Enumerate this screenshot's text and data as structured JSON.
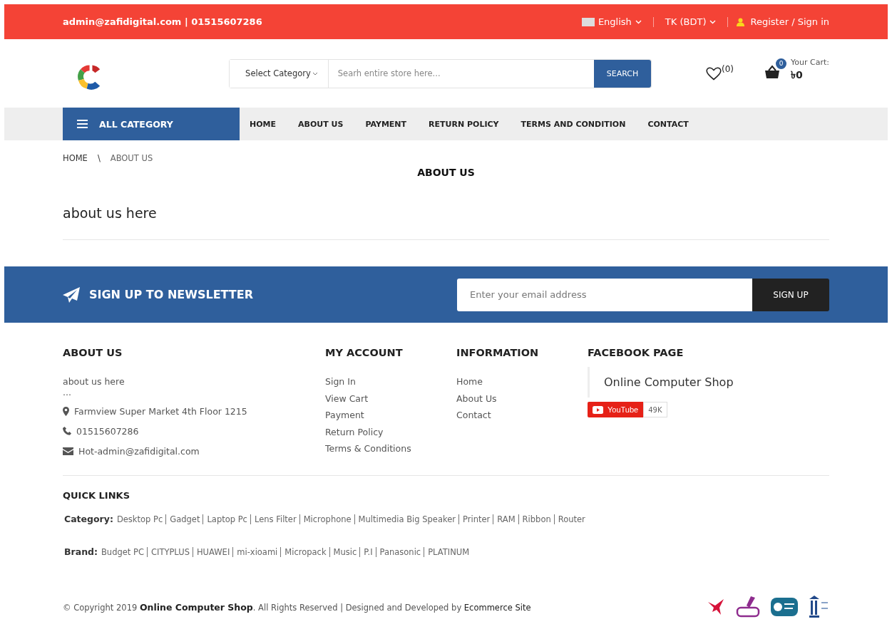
{
  "topbar": {
    "contact": "admin@zafidigital.com | 01515607286",
    "language": "English",
    "currency": "TK (BDT)",
    "account": "Register / Sign in"
  },
  "search": {
    "category": "Select Category",
    "placeholder": "Searh entire store here...",
    "button": "SEARCH"
  },
  "wishlist": {
    "count": "(0)"
  },
  "cart": {
    "badge": "0",
    "label": "Your Cart:",
    "total": "৳0"
  },
  "nav": {
    "category_button": "ALL CATEGORY",
    "items": [
      "HOME",
      "ABOUT US",
      "PAYMENT",
      "RETURN POLICY",
      "TERMS AND CONDITION",
      "CONTACT"
    ]
  },
  "breadcrumb": {
    "separator": "\\",
    "items": [
      "HOME",
      "ABOUT US"
    ]
  },
  "page": {
    "title": "ABOUT US",
    "body": "about us here"
  },
  "newsletter": {
    "title": "SIGN UP TO NEWSLETTER",
    "placeholder": "Enter your email address",
    "button": "SIGN UP"
  },
  "footer": {
    "about": {
      "title": "ABOUT US",
      "text": "about us here",
      "ellipsis": "...",
      "address": "Farmview Super Market 4th Floor 1215",
      "phone": "01515607286",
      "email": "Hot-admin@zafidigital.com"
    },
    "columns": [
      {
        "title": "MY ACCOUNT",
        "links": [
          "Sign In",
          "View Cart",
          "Payment",
          "Return Policy",
          "Terms & Conditions"
        ]
      },
      {
        "title": "INFORMATION",
        "links": [
          "Home",
          "About Us",
          "Contact"
        ]
      }
    ],
    "facebook": {
      "title": "FACEBOOK PAGE",
      "page_name": "Online Computer Shop",
      "youtube": "YouTube",
      "subscribers": "49K"
    }
  },
  "quick_links": {
    "title": "QUICK LINKS",
    "groups": [
      {
        "label": "Category:",
        "links": [
          "Desktop Pc",
          "Gadget",
          "Laptop Pc",
          "Lens Filter",
          "Microphone",
          "Multimedia Big Speaker",
          "Printer",
          "RAM",
          "Ribbon",
          "Router"
        ]
      },
      {
        "label": "Brand:",
        "links": [
          "Budget PC",
          "CITYPLUS",
          "HUAWEI",
          "mi-xioami",
          "Micropack",
          "Music",
          "P.I",
          "Panasonic",
          "PLATINUM"
        ]
      }
    ]
  },
  "copyright": {
    "text": "© Copyright 2019 **Online Computer Shop**. All Rights Reserved | Designed and Developed by",
    "link": "Ecommerce Site"
  }
}
